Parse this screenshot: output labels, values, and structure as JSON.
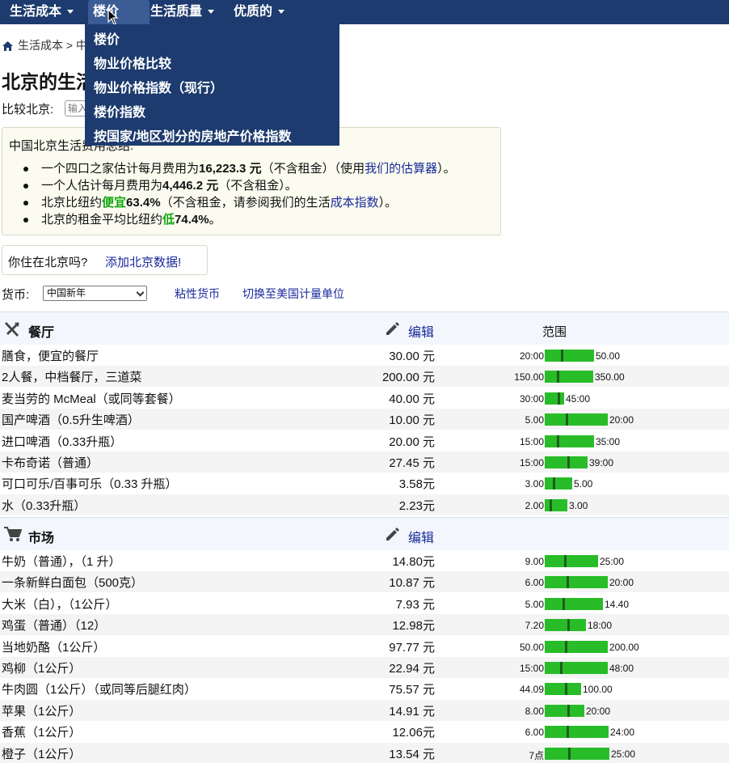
{
  "nav": {
    "items": [
      "生活成本",
      "楼价",
      "生活质量",
      "优质的"
    ],
    "dropdown": [
      "楼价",
      "物业价格比较",
      "物业价格指数（现行）",
      "楼价指数",
      "按国家/地区划分的房地产价格指数"
    ]
  },
  "breadcrumb": {
    "text": "生活成本 > 中"
  },
  "page_title": "北京的生活",
  "compare": {
    "label": "比较北京:",
    "placeholder": "输入"
  },
  "summary": {
    "heading": "中国北京生活费用总结:",
    "line1": {
      "pre": "一个四口之家估计每月费用为",
      "value": "16,223.3 元",
      "mid": "（不含租金）（使用",
      "link": "我们的估算器",
      "post": "）。"
    },
    "line2": {
      "pre": "一个人估计每月费用为",
      "value": "4,446.2 元",
      "post": "（不含租金）。"
    },
    "line3": {
      "pre": "北京比纽约",
      "green": "便宜",
      "value": "63.4%",
      "mid": "（不含租金，请参阅我们的生活",
      "link": "成本指数",
      "post": "）。"
    },
    "line4": {
      "pre": "北京的租金平均比纽约",
      "green": "低",
      "value": "74.4%",
      "post": "。"
    }
  },
  "live": {
    "question": "你住在北京吗?",
    "link": "添加北京数据!"
  },
  "currency": {
    "label": "货币:",
    "selected": "中国新年",
    "sticky": "粘性货币",
    "units": "切换至美国计量单位"
  },
  "sections": [
    {
      "title": "餐厅",
      "icon": "fork-knife-icon",
      "edit": "编辑",
      "range_label": "范围",
      "rows": [
        {
          "item": "膳食，便宜的餐厅",
          "price": "30.00 元",
          "min": "20:00",
          "max": "50.00",
          "avg_frac": 0.33
        },
        {
          "item": "2人餐，中档餐厅，三道菜",
          "price": "200.00 元",
          "min": "150.00",
          "max": "350.00",
          "avg_frac": 0.25
        },
        {
          "item": "麦当劳的 McMeal（或同等套餐）",
          "price": "40.00 元",
          "min": "30:00",
          "max": "45:00",
          "avg_frac": 0.67
        },
        {
          "item": "国产啤酒（0.5升生啤酒）",
          "price": "10.00 元",
          "min": "5.00",
          "max": "20:00",
          "avg_frac": 0.33
        },
        {
          "item": "进口啤酒（0.33升瓶）",
          "price": "20.00 元",
          "min": "15:00",
          "max": "35:00",
          "avg_frac": 0.25
        },
        {
          "item": "卡布奇诺（普通）",
          "price": "27.45 元",
          "min": "15:00",
          "max": "39:00",
          "avg_frac": 0.52
        },
        {
          "item": "可口可乐/百事可乐（0.33 升瓶）",
          "price": "3.58元",
          "min": "3.00",
          "max": "5.00",
          "avg_frac": 0.29
        },
        {
          "item": "水（0.33升瓶）",
          "price": "2.23元",
          "min": "2.00",
          "max": "3.00",
          "avg_frac": 0.23
        }
      ]
    },
    {
      "title": "市场",
      "icon": "cart-icon",
      "edit": "编辑",
      "range_label": "",
      "rows": [
        {
          "item": "牛奶（普通），（1 升）",
          "price": "14.80元",
          "min": "9.00",
          "max": "25:00",
          "avg_frac": 0.36
        },
        {
          "item": "一条新鲜白面包（500克）",
          "price": "10.87 元",
          "min": "6.00",
          "max": "20:00",
          "avg_frac": 0.35
        },
        {
          "item": "大米（白），（1公斤）",
          "price": "7.93 元",
          "min": "5.00",
          "max": "14.40",
          "avg_frac": 0.31
        },
        {
          "item": "鸡蛋（普通）（12）",
          "price": "12.98元",
          "min": "7.20",
          "max": "18:00",
          "avg_frac": 0.54
        },
        {
          "item": "当地奶酪（1公斤）",
          "price": "97.77 元",
          "min": "50.00",
          "max": "200.00",
          "avg_frac": 0.32
        },
        {
          "item": "鸡柳（1公斤）",
          "price": "22.94 元",
          "min": "15:00",
          "max": "48:00",
          "avg_frac": 0.24
        },
        {
          "item": "牛肉圆（1公斤）（或同等后腿红肉）",
          "price": "75.57 元",
          "min": "44.09",
          "max": "100.00",
          "avg_frac": 0.56
        },
        {
          "item": "苹果（1公斤）",
          "price": "14.91 元",
          "min": "8.00",
          "max": "20:00",
          "avg_frac": 0.58
        },
        {
          "item": "香蕉（1公斤）",
          "price": "12.06元",
          "min": "6.00",
          "max": "24:00",
          "avg_frac": 0.34
        },
        {
          "item": "橙子（1公斤）",
          "price": "13.54 元",
          "min": "7点",
          "max": "25:00",
          "avg_frac": 0.36
        }
      ]
    }
  ]
}
